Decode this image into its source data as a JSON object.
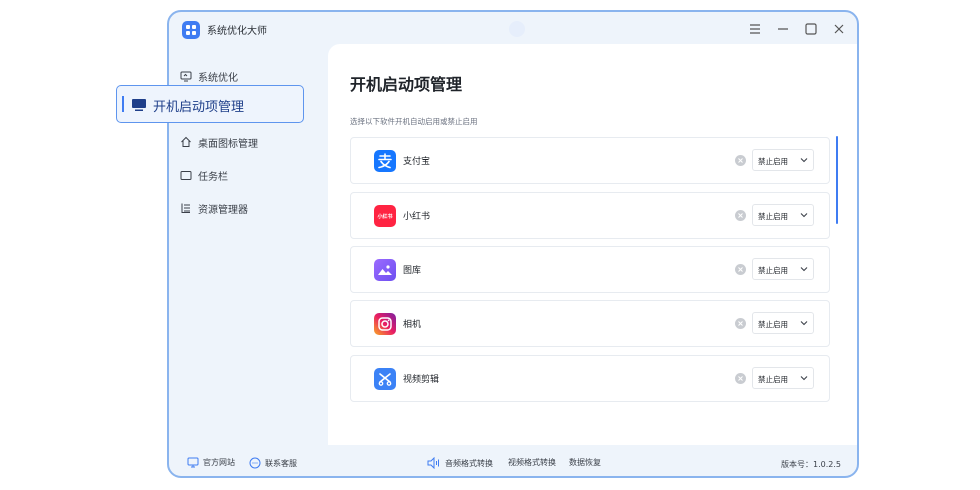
{
  "window": {
    "title": "系统优化大师"
  },
  "sidebar": {
    "items": [
      {
        "label": "系统优化"
      },
      {
        "label": "开机启动项管理"
      },
      {
        "label": "桌面图标管理"
      },
      {
        "label": "任务栏"
      },
      {
        "label": "资源管理器"
      }
    ]
  },
  "main": {
    "title": "开机启动项管理",
    "subtitle": "选择以下软件开机自动启用或禁止启用",
    "apps": [
      {
        "name": "支付宝",
        "status": "禁止启用"
      },
      {
        "name": "小红书",
        "status": "禁止启用",
        "icon_text": "小红书"
      },
      {
        "name": "图库",
        "status": "禁止启用"
      },
      {
        "name": "相机",
        "status": "禁止启用"
      },
      {
        "name": "视频剪辑",
        "status": "禁止启用"
      }
    ]
  },
  "footer": {
    "website": "官方网站",
    "support": "联系客服",
    "tools": [
      "音频格式转换",
      "视频格式转换",
      "数据恢复"
    ],
    "version": "版本号：1.0.2.5"
  },
  "colors": {
    "accent": "#3f7cf2",
    "border": "#8ab4ee"
  }
}
